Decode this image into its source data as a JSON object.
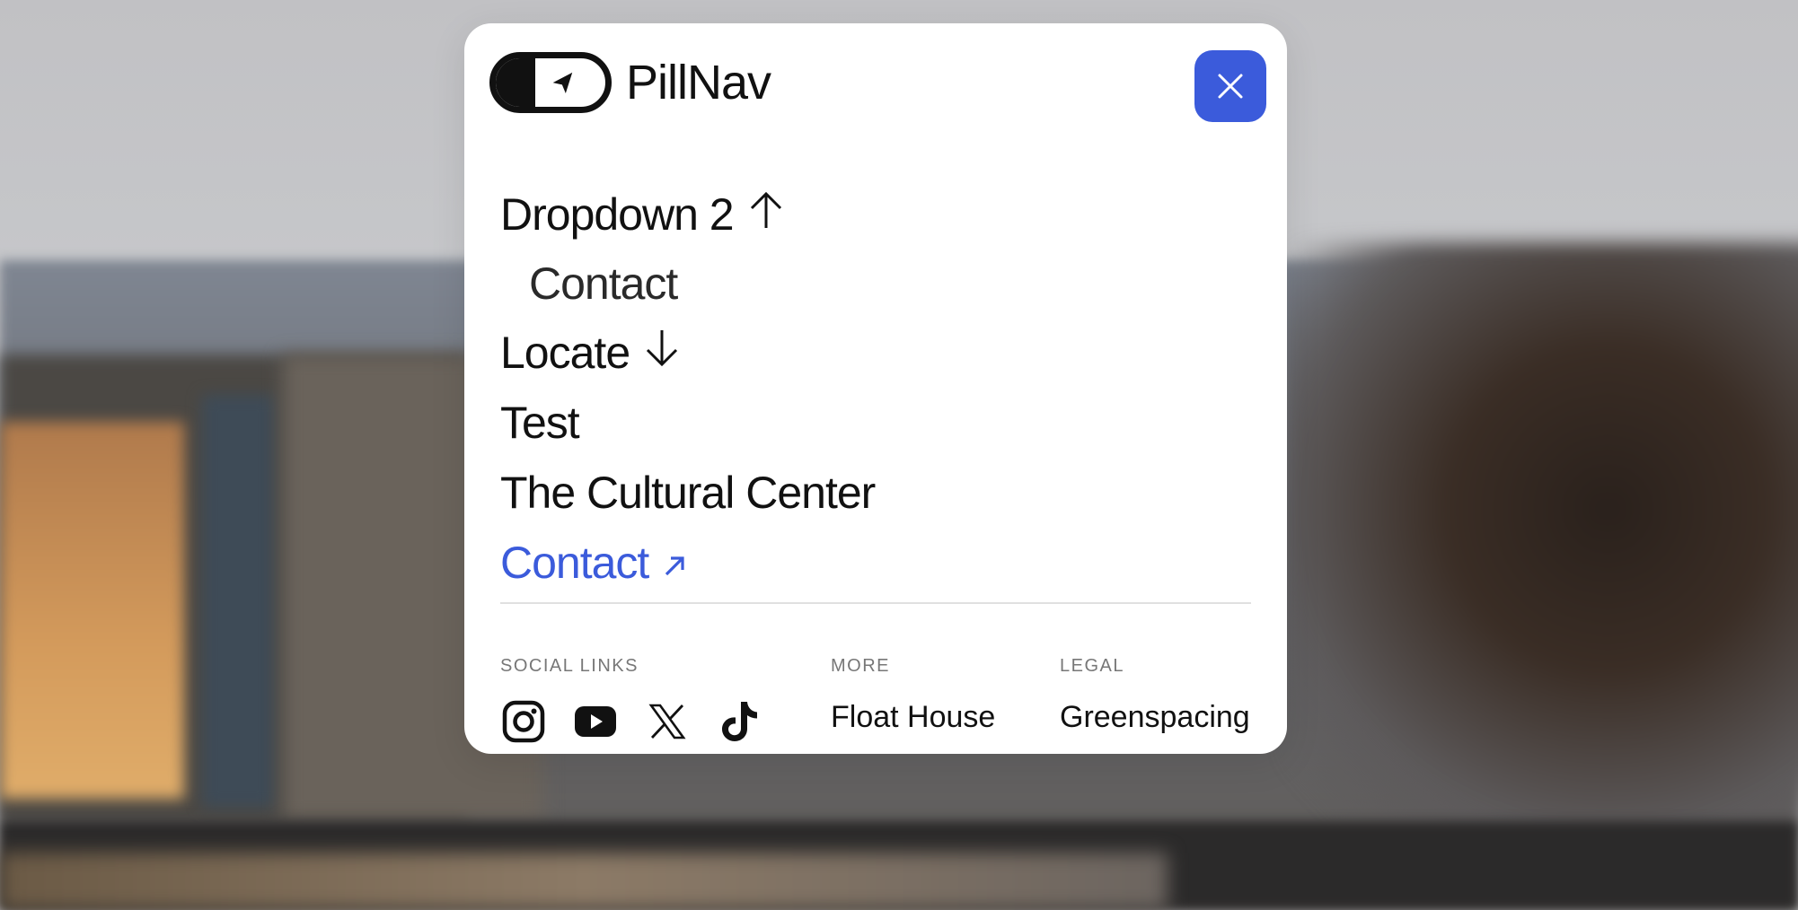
{
  "brand": {
    "name": "PillNav",
    "logo_icon": "navigation-arrow-icon"
  },
  "close_button": {
    "icon": "close-icon",
    "color": "#3b5bdb"
  },
  "menu": {
    "items": [
      {
        "label": "Dropdown 2",
        "icon": "arrow-up-icon"
      },
      {
        "label": "Contact",
        "sub": true
      },
      {
        "label": "Locate",
        "icon": "arrow-down-icon"
      },
      {
        "label": "Test"
      },
      {
        "label": "The Cultural Center"
      },
      {
        "label": "Contact",
        "icon": "arrow-up-right-icon",
        "accent": "#3b5bdb"
      }
    ]
  },
  "footer": {
    "social_title": "SOCIAL LINKS",
    "social_icons": [
      "instagram-icon",
      "youtube-icon",
      "x-icon",
      "tiktok-icon"
    ],
    "more_title": "MORE",
    "more_link": "Float House",
    "legal_title": "LEGAL",
    "legal_link": "Greenspacing"
  }
}
